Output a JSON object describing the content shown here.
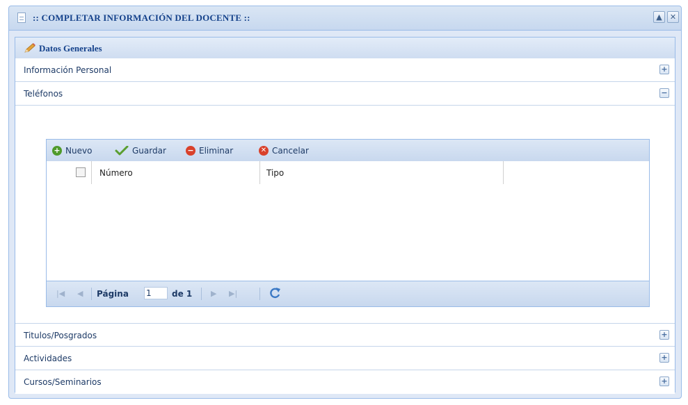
{
  "window": {
    "title": ":: COMPLETAR INFORMACIÓN DEL DOCENTE ::",
    "collapse_icon": "▲",
    "close_icon": "✕"
  },
  "panel": {
    "title": "Datos Generales"
  },
  "sections": [
    {
      "label": "Información Personal",
      "toggle": "+"
    },
    {
      "label": "Teléfonos",
      "toggle": "−"
    },
    {
      "label": "Titulos/Posgrados",
      "toggle": "+"
    },
    {
      "label": "Actividades",
      "toggle": "+"
    },
    {
      "label": "Cursos/Seminarios",
      "toggle": "+"
    }
  ],
  "toolbar": {
    "nuevo": "Nuevo",
    "guardar": "Guardar",
    "eliminar": "Eliminar",
    "cancelar": "Cancelar"
  },
  "grid": {
    "columns": [
      "Número",
      "Tipo"
    ],
    "rows": []
  },
  "pager": {
    "page_label": "Página",
    "page_value": "1",
    "of_label": "de 1"
  },
  "colors": {
    "accent": "#15428b",
    "border": "#99bbe8",
    "add_green": "#4f9a2a",
    "check_green": "#5a9e2f",
    "remove_red": "#d9412b"
  }
}
